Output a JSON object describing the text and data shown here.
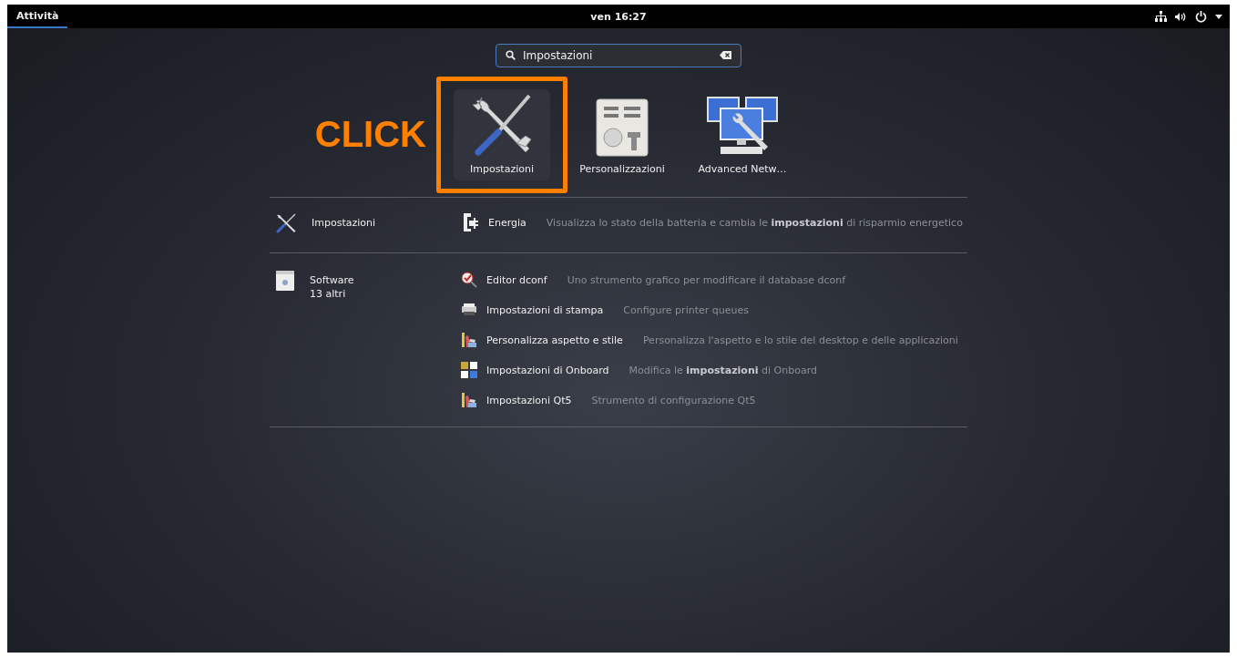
{
  "top_bar": {
    "activities": "Attività",
    "clock": "ven 16:27"
  },
  "search": {
    "value": "Impostazioni"
  },
  "annotation": {
    "text": "CLICK"
  },
  "app_grid": [
    {
      "name": "Impostazioni",
      "kind": "settings",
      "selected": true
    },
    {
      "name": "Personalizzazioni",
      "kind": "tweaks",
      "selected": false
    },
    {
      "name": "Advanced Netw…",
      "kind": "network",
      "selected": false
    }
  ],
  "providers": [
    {
      "name": "Impostazioni",
      "kind": "settings",
      "results": [
        {
          "name": "Energia",
          "kind": "power",
          "description": "Visualizza lo stato della batteria e cambia le **impostazioni** di risparmio energetico"
        }
      ]
    },
    {
      "name": "Software",
      "more": "13 altri",
      "kind": "software",
      "results": [
        {
          "name": "Editor dconf",
          "kind": "dconf",
          "description": "Uno strumento grafico per modificare il database dconf"
        },
        {
          "name": "Impostazioni di stampa",
          "kind": "printer",
          "description": "Configure printer queues"
        },
        {
          "name": "Personalizza aspetto e stile",
          "kind": "palette",
          "description": "Personalizza l'aspetto e lo stile del desktop e delle applicazioni"
        },
        {
          "name": "Impostazioni di Onboard",
          "kind": "onboard",
          "description": "Modifica le **impostazioni** di Onboard"
        },
        {
          "name": "Impostazioni Qt5",
          "kind": "palette",
          "description": "Strumento di configurazione Qt5"
        }
      ]
    }
  ]
}
